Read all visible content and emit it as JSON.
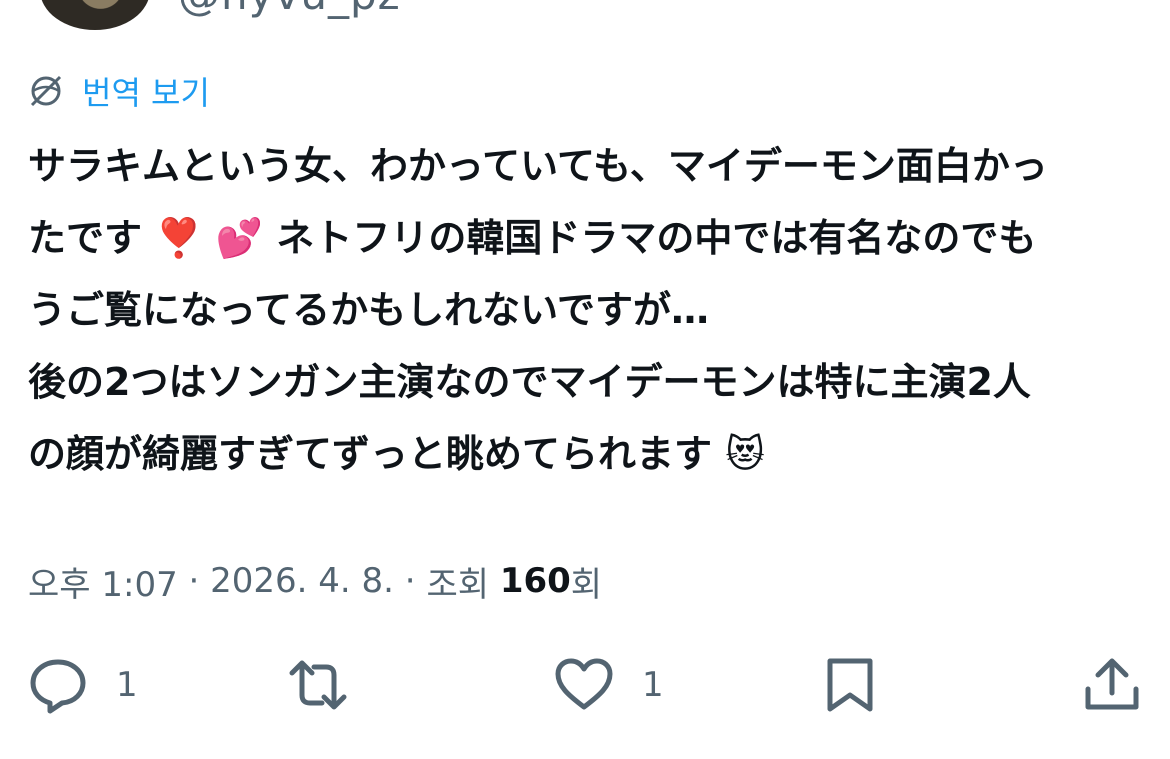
{
  "header": {
    "handle": "@nyvu_pz"
  },
  "translate": {
    "label": "번역 보기",
    "icon": "translate-globe-icon"
  },
  "tweet": {
    "lines": [
      "サラキムという女、わかっていても、マイデーモン面白かっ",
      "たです ❣️ 💕 ネトフリの韓国ドラマの中では有名なのでも",
      "うご覧になってるかもしれないですが…",
      "後の2つはソンガン主演なのでマイデーモンは特に主演2人",
      "の顔が綺麗すぎてずっと眺めてられます 😻"
    ]
  },
  "meta": {
    "time": "오후 1:07",
    "sep1": " · ",
    "date": "2026. 4. 8.",
    "sep2": " · ",
    "views_prefix": "조회 ",
    "views_count": "160",
    "views_suffix": "회"
  },
  "actions": {
    "reply": {
      "icon": "reply-icon",
      "count": "1"
    },
    "retweet": {
      "icon": "retweet-icon",
      "count": ""
    },
    "like": {
      "icon": "heart-icon",
      "count": "1"
    },
    "bookmark": {
      "icon": "bookmark-icon"
    },
    "share": {
      "icon": "share-icon"
    }
  },
  "colors": {
    "text": "#0f1419",
    "secondary": "#536471",
    "accent": "#1d9bf0"
  }
}
